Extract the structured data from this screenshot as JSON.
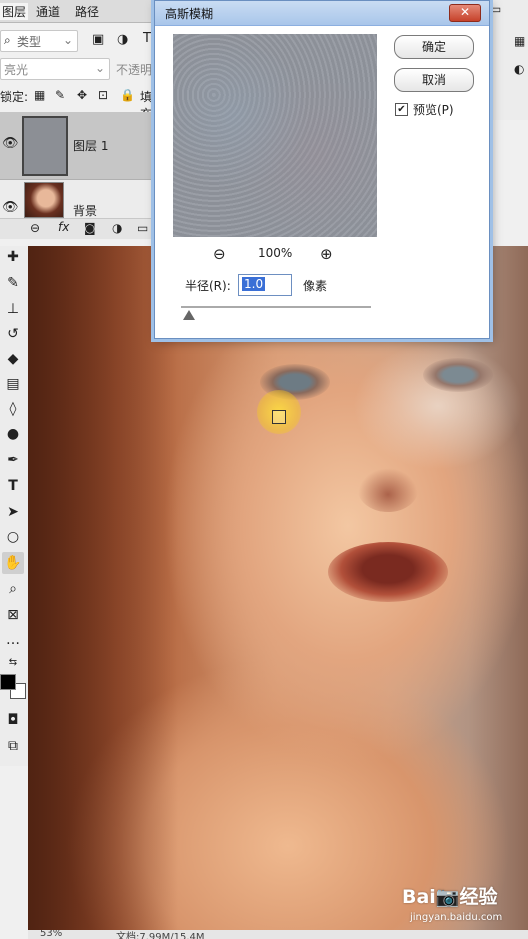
{
  "layers_panel": {
    "tabs": [
      {
        "label": "图层"
      },
      {
        "label": "通道"
      },
      {
        "label": "路径"
      }
    ],
    "filter_kind": "类型",
    "blend_mode": "亮光",
    "opacity_label": "不透明度",
    "lock_label": "锁定:",
    "fill_label": "填充",
    "layers": [
      {
        "name": "图层 1",
        "visible": true,
        "selected": true
      },
      {
        "name": "背景",
        "visible": true,
        "selected": false
      }
    ]
  },
  "dialog": {
    "title": "高斯模糊",
    "close_icon": "close-icon",
    "ok_label": "确定",
    "cancel_label": "取消",
    "preview_label": "预览(P)",
    "preview_checked": true,
    "zoom_level": "100%",
    "radius_label": "半径(R):",
    "radius_value": "1.0",
    "radius_unit": "像素"
  },
  "status_bar": {
    "zoom": "53%",
    "doc_info": "文档:7.99M/15.4M"
  },
  "watermark": {
    "brand": "Bai📷经验",
    "url": "jingyan.baidu.com"
  }
}
